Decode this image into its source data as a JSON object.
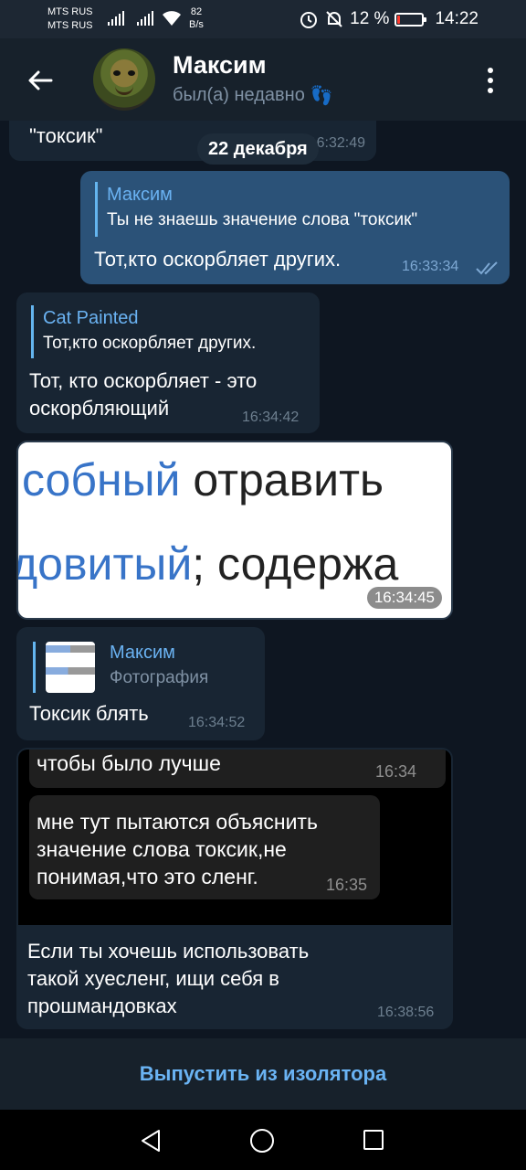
{
  "status_bar": {
    "carrier1": "MTS RUS",
    "carrier2": "MTS RUS",
    "net_speed_value": "82",
    "net_speed_unit": "B/s",
    "battery": "12 %",
    "battery_level": 0.12,
    "time": "14:22"
  },
  "header": {
    "name": "Максим",
    "status": "был(а) недавно",
    "status_emoji": "👣"
  },
  "messages": {
    "m0": {
      "text": "\"токсик\"",
      "time": "16:32:49"
    },
    "date": "22 декабря",
    "m1": {
      "reply_name": "Максим",
      "reply_text": "Ты не знаешь значение слова \"токсик\"",
      "text": "Тот,кто оскорбляет других.",
      "time": "16:33:34"
    },
    "m2": {
      "reply_name": "Cat Painted",
      "reply_text": "Тот,кто оскорбляет других.",
      "text_line1": "Тот, кто оскорбляет - это",
      "text_line2": "оскорбляющий",
      "time": "16:34:42"
    },
    "m3": {
      "photo_line1_blue": "собный",
      "photo_line1_dark": " отравить",
      "photo_line2_blue": "довитый",
      "photo_line2_dark": "; содержа",
      "time": "16:34:45"
    },
    "m4": {
      "reply_name": "Максим",
      "reply_text": "Фотография",
      "text": "Токсик блять",
      "time": "16:34:52"
    },
    "m5": {
      "shot_line1": "чтобы было лучше",
      "shot_time1": "16:34",
      "shot_line2": "мне тут пытаются объяснить",
      "shot_line3": "значение слова токсик,не",
      "shot_line4": "понимая,что это сленг.",
      "shot_time2": "16:35",
      "text_line1": "Если ты хочешь использовать",
      "text_line2": "такой хуесленг,  ищи себя в",
      "text_line3": "прошмандовках",
      "time": "16:38:56"
    }
  },
  "bottom_action": "Выпустить из изолятора"
}
